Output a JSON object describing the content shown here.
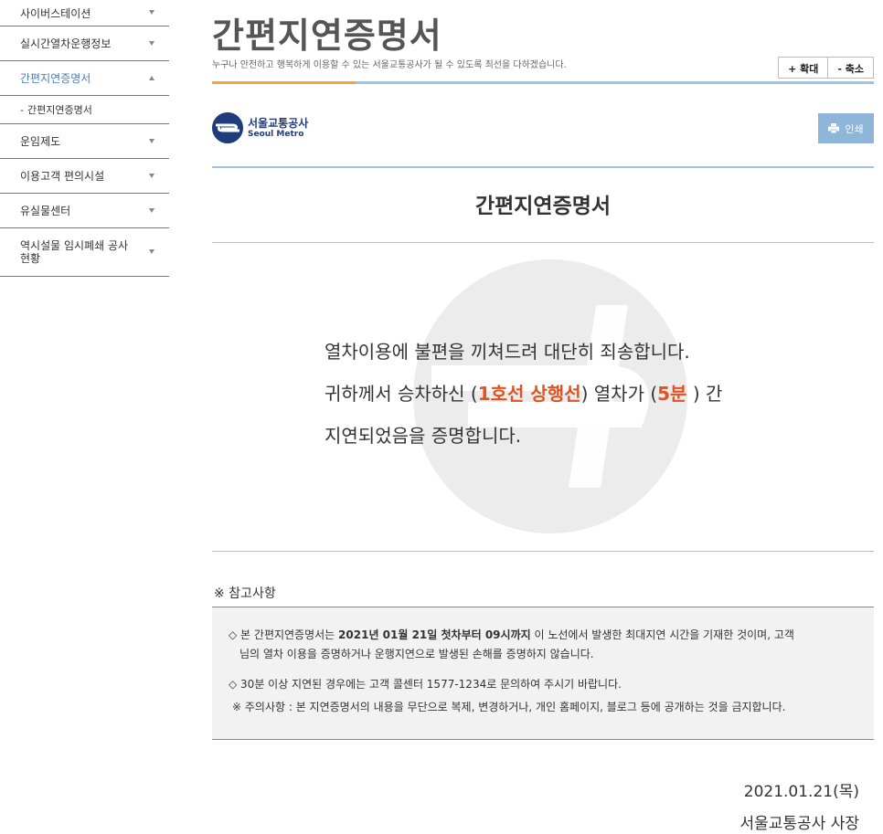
{
  "sidebar": {
    "items": [
      {
        "label": "사이버스테이션"
      },
      {
        "label": "실시간열차운행정보"
      },
      {
        "label": "간편지연증명서"
      },
      {
        "label": "운임제도"
      },
      {
        "label": "이용고객 편의시설"
      },
      {
        "label": "유실물센터"
      },
      {
        "label": "역시설물 임시폐쇄 공사현황"
      }
    ],
    "sub_item": {
      "label": "간편지연증명서",
      "dash": "-"
    }
  },
  "header": {
    "title": "간편지연증명서",
    "subtitle": "누구나 안전하고 행복하게 이용할 수 있는 서울교통공사가 될 수 있도록 최선을 다하겠습니다.",
    "zoom_in": "+ 확대",
    "zoom_out": "- 축소"
  },
  "logo": {
    "kr": "서울교통공사",
    "en": "Seoul Metro"
  },
  "print_label": "인쇄",
  "certificate": {
    "title": "간편지연증명서",
    "line1": "열차이용에 불편을 끼쳐드려 대단히 죄송합니다.",
    "line2_pre": "귀하께서 승차하신 (",
    "line2_line": "1호선 상행선",
    "line2_mid": ") 열차가 (",
    "line2_delay": "5분",
    "line2_post": " ) 간",
    "line3": "지연되었음을 증명합니다."
  },
  "reference": {
    "title": "※ 참고사항",
    "p1_pre": "◇ 본 간편지연증명서는 ",
    "p1_bold": "2021년 01월 21일 첫차부터 09시까지",
    "p1_post": " 이 노선에서 발생한 최대지연 시간을 기재한 것이며, 고객",
    "p1_cont": "님의 열차 이용을 증명하거나 운행지연으로 발생된 손해를 증명하지 않습니다.",
    "p2": "◇ 30분 이상 지연된 경우에는 고객 콜센터 1577-1234로 문의하여 주시기 바랍니다.",
    "p3": "※ 주의사항 : 본 지연증명서의 내용을 무단으로 복제, 변경하거나, 개인 홈페이지, 블로그 등에 공개하는 것을 금지합니다."
  },
  "footer": {
    "date": "2021.01.21(목)",
    "signature": "서울교통공사 사장"
  },
  "colors": {
    "accent_blue": "#9cc4e4",
    "accent_orange": "#f5a53a",
    "highlight": "#e2531f",
    "brand": "#1f3d7a"
  }
}
